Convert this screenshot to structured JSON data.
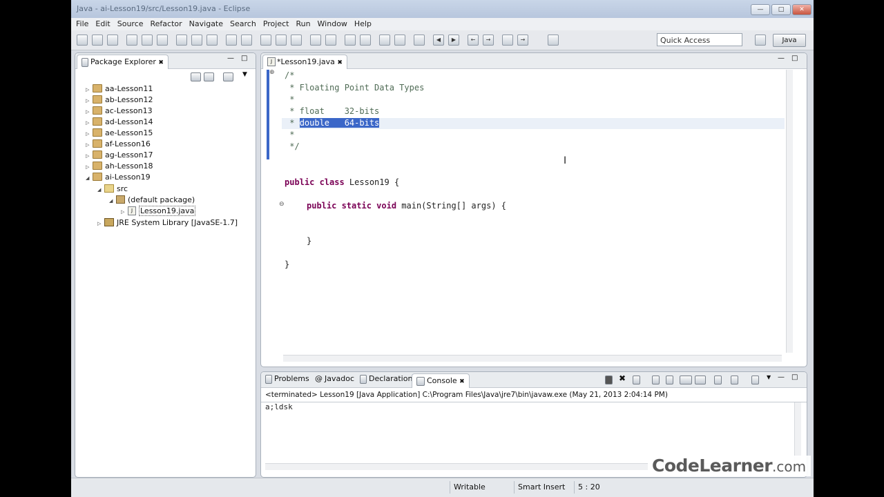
{
  "window": {
    "title": "Java - ai-Lesson19/src/Lesson19.java - Eclipse"
  },
  "menu": [
    "File",
    "Edit",
    "Source",
    "Refactor",
    "Navigate",
    "Search",
    "Project",
    "Run",
    "Window",
    "Help"
  ],
  "toolbar": {
    "quick_access": "Quick Access",
    "perspective": "Java"
  },
  "package_explorer": {
    "title": "Package Explorer",
    "projects": [
      "aa-Lesson11",
      "ab-Lesson12",
      "ac-Lesson13",
      "ad-Lesson14",
      "ae-Lesson15",
      "af-Lesson16",
      "ag-Lesson17",
      "ah-Lesson18",
      "ai-Lesson19"
    ],
    "src": "src",
    "default_package": "(default package)",
    "file": "Lesson19.java",
    "jre": "JRE System Library [JavaSE-1.7]"
  },
  "editor": {
    "tab": "*Lesson19.java",
    "lines": {
      "l1": "/*",
      "l2": " * Floating Point Data Types",
      "l3": " *",
      "l4": " * float    32-bits",
      "l5_star": " * ",
      "l5_sel": "double   64-bits",
      "l6": " *",
      "l7": " */",
      "l8_kw": "public class",
      "l8_rest": " Lesson19 {",
      "l9_kw": "public static void",
      "l9_rest": " main(String[] args) {",
      "l10": "}",
      "l11": "}"
    }
  },
  "bottom": {
    "tabs": [
      "Problems",
      "Javadoc",
      "Declaration",
      "Console"
    ],
    "console_header": "<terminated> Lesson19 [Java Application] C:\\Program Files\\Java\\jre7\\bin\\javaw.exe (May 21, 2013 2:04:14 PM)",
    "console_output": "a;ldsk"
  },
  "status": {
    "writable": "Writable",
    "insert": "Smart Insert",
    "position": "5 : 20"
  },
  "watermark": {
    "part1": "CodeLearner",
    "part2": ".com"
  }
}
